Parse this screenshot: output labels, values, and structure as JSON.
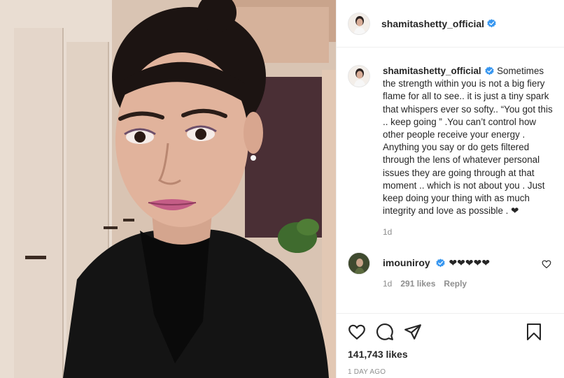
{
  "post": {
    "username": "shamitashetty_official",
    "caption": "Sometimes the strength within you is not a big fiery flame for all to see.. it is just a tiny spark that whispers ever so softy.. “You got this .. keep going ” .You can’t control how other people receive your energy . Anything you say or do gets filtered through the lens of whatever personal issues they are going through at that moment .. which is not about you . Just keep doing your thing with as much integrity and love as possible . ❤",
    "caption_time": "1d",
    "likes": "141,743 likes",
    "date": "1 DAY AGO"
  },
  "comment": {
    "username": "imouniroy",
    "text": "❤❤❤❤❤",
    "time": "1d",
    "likes": "291 likes",
    "reply": "Reply"
  },
  "icons": {
    "verified": "verified-badge-icon",
    "like": "heart-icon",
    "comment": "comment-icon",
    "share": "paper-plane-icon",
    "save": "bookmark-icon"
  },
  "colors": {
    "verified": "#3897f0",
    "meta": "#8e8e8e",
    "text": "#262626"
  }
}
